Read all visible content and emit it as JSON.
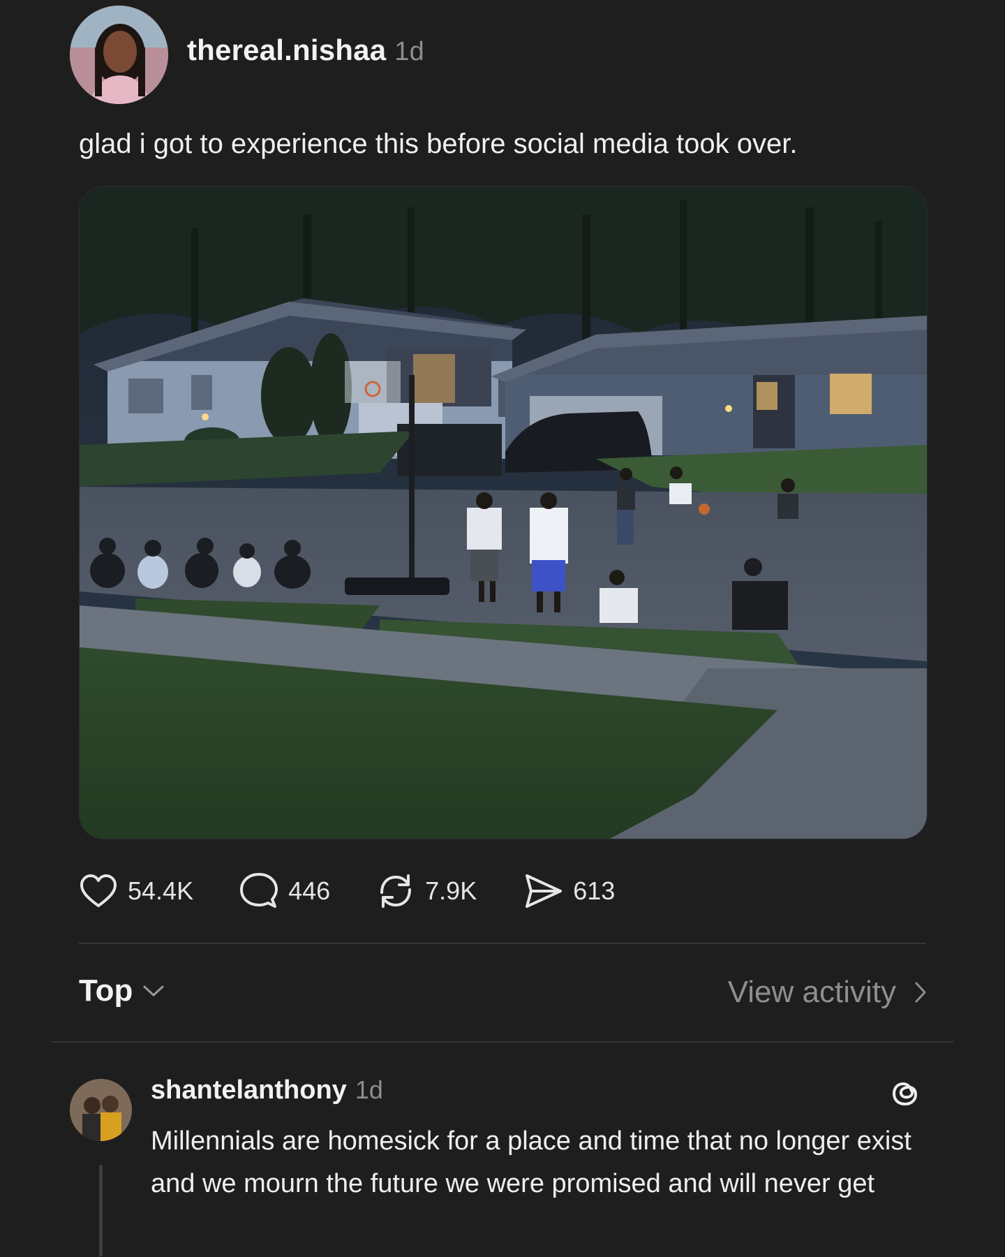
{
  "post": {
    "username": "thereal.nishaa",
    "time": "1d",
    "text": "glad i got to experience this before social media took over.",
    "image_alt": "Kids playing basketball on a neighborhood street at dusk"
  },
  "actions": {
    "likes": "54.4K",
    "replies": "446",
    "reposts": "7.9K",
    "shares": "613"
  },
  "sort": {
    "label": "Top",
    "view_activity": "View activity"
  },
  "reply": {
    "username": "shantelanthony",
    "time": "1d",
    "text": "Millennials are homesick for a place and time that no longer exist and we mourn the future we were promised and will never get"
  },
  "colors": {
    "background": "#1e1e1f",
    "text": "#f2f2f2",
    "muted": "#8e8e8e",
    "divider": "#363636"
  },
  "icons": [
    "heart-icon",
    "comment-icon",
    "repost-icon",
    "share-icon",
    "chevron-down-icon",
    "chevron-right-icon",
    "threads-icon"
  ]
}
